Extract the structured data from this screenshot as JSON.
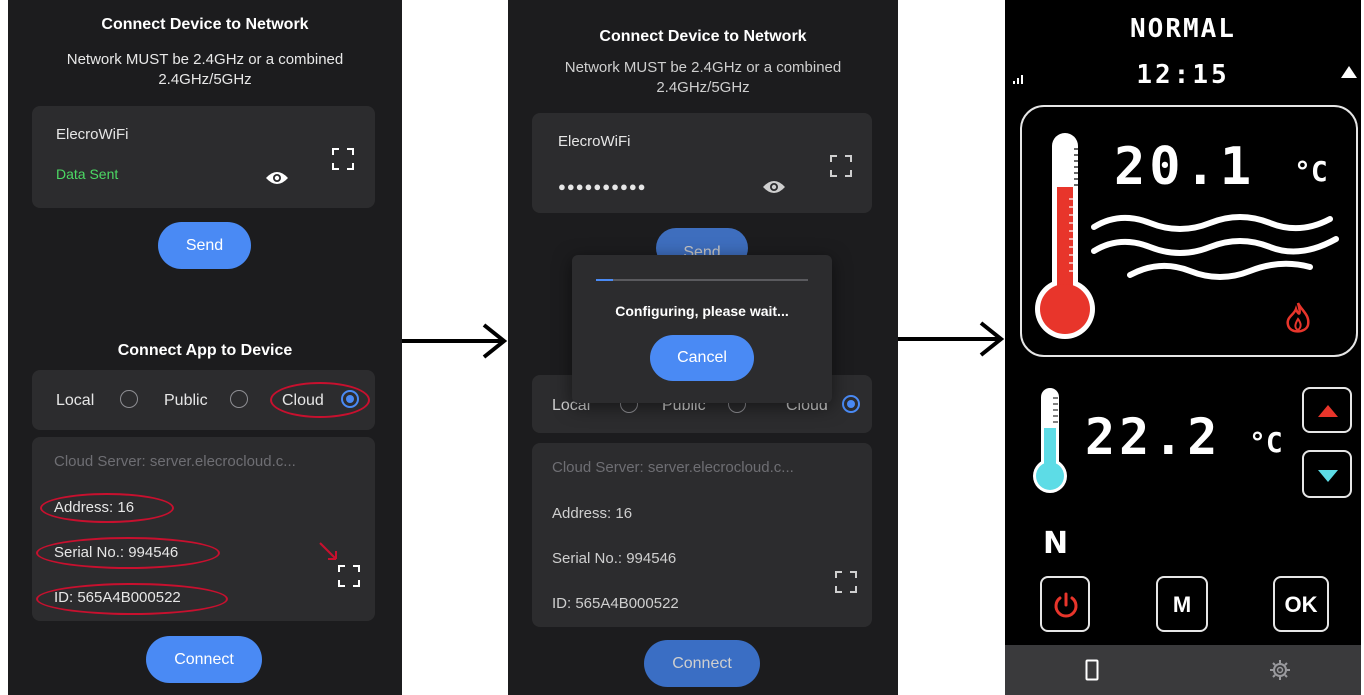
{
  "screen1": {
    "title": "Connect Device to Network",
    "subtitle_line1": "Network MUST be 2.4GHz or a combined",
    "subtitle_line2": "2.4GHz/5GHz",
    "wifi_name": "ElecroWiFi",
    "status": "Data Sent",
    "send_label": "Send",
    "section2_title": "Connect App to Device",
    "radio_local": "Local",
    "radio_public": "Public",
    "radio_cloud": "Cloud",
    "selected_radio": "Cloud",
    "cloud_server": "Cloud Server:  server.elecrocloud.c...",
    "address": "Address: 16",
    "serial": "Serial No.: 994546",
    "id": "ID: 565A4B000522",
    "connect_label": "Connect",
    "annotation_color": "#c8102e"
  },
  "screen2": {
    "title": "Connect Device to Network",
    "subtitle_line1": "Network MUST be 2.4GHz or a combined",
    "subtitle_line2": "2.4GHz/5GHz",
    "wifi_name": "ElecroWiFi",
    "password_mask": "●●●●●●●●●●",
    "send_label": "Send",
    "dialog_message": "Configuring, please wait...",
    "dialog_cancel": "Cancel",
    "progress_fraction": 0.08,
    "radio_local": "Local",
    "radio_public": "Public",
    "radio_cloud": "Cloud",
    "cloud_server": "Cloud Server:  server.elecrocloud.c...",
    "address": "Address: 16",
    "serial": "Serial No.: 994546",
    "id": "ID: 565A4B000522",
    "connect_label": "Connect"
  },
  "screen3": {
    "mode": "NORMAL",
    "time": "12:15",
    "water_temp": "20.1",
    "water_unit": "°C",
    "room_temp": "22.2",
    "room_unit": "°C",
    "mode_letter": "N",
    "btn_m": "M",
    "btn_ok": "OK",
    "icons": [
      "signal-icon",
      "thermometer-icon",
      "waves-icon",
      "flame-icon",
      "up-arrow-icon",
      "down-arrow-icon",
      "power-icon",
      "phone-icon",
      "gear-icon"
    ],
    "colors": {
      "red": "#e8352b",
      "cyan": "#5ddce6",
      "blue": "#4a8af4"
    }
  }
}
